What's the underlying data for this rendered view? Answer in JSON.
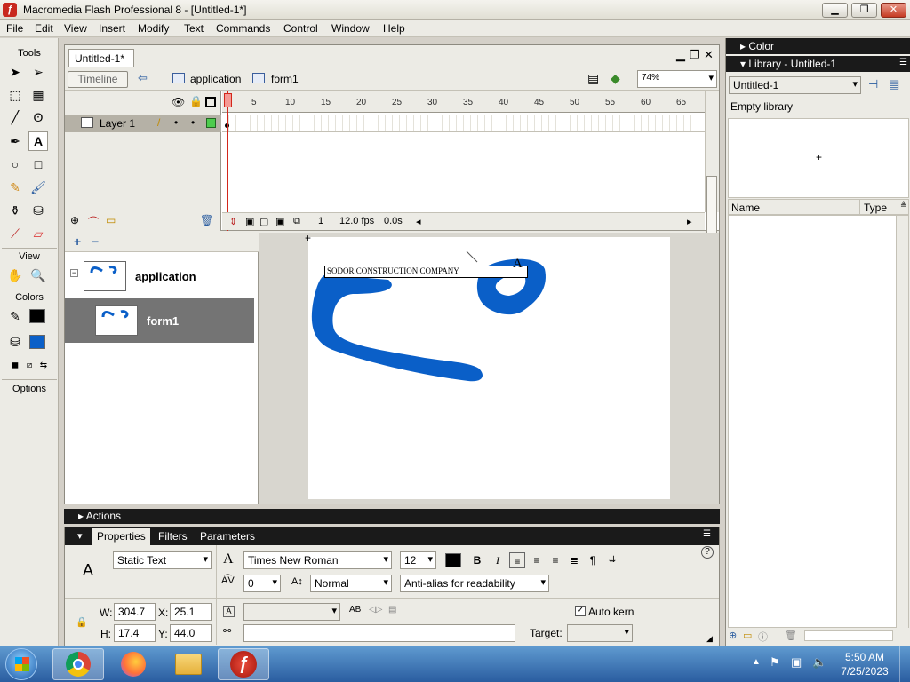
{
  "window": {
    "title": "Macromedia Flash Professional 8 - [Untitled-1*]",
    "minimize": "▁",
    "maximize": "❐",
    "close": "✕"
  },
  "menu": [
    "File",
    "Edit",
    "View",
    "Insert",
    "Modify",
    "Text",
    "Commands",
    "Control",
    "Window",
    "Help"
  ],
  "tools": {
    "header": "Tools",
    "view_header": "View",
    "colors_header": "Colors",
    "options_header": "Options",
    "stroke_color": "#000000",
    "fill_color": "#0a5fc8"
  },
  "document": {
    "tab": "Untitled-1*",
    "timeline_button": "Timeline",
    "breadcrumb": [
      "application",
      "form1"
    ],
    "zoom": "74%"
  },
  "timeline": {
    "layer_name": "Layer 1",
    "frame_ticks": [
      "5",
      "10",
      "15",
      "20",
      "25",
      "30",
      "35",
      "40",
      "45",
      "50",
      "55",
      "60",
      "65"
    ],
    "current_frame": "1",
    "fps": "12.0 fps",
    "time": "0.0s"
  },
  "screens": {
    "items": [
      {
        "name": "application",
        "selected": false
      },
      {
        "name": "form1",
        "selected": true
      }
    ]
  },
  "stage": {
    "text_field": "SODOR CONSTRUCTION COMPANY",
    "shape_color": "#0a5fc8"
  },
  "actions_panel": {
    "label": "Actions"
  },
  "properties": {
    "tabs": [
      "Properties",
      "Filters",
      "Parameters"
    ],
    "text_type": "Static Text",
    "font": "Times New Roman",
    "font_size": "12",
    "letter_spacing": "0",
    "position": "Normal",
    "antialias": "Anti-alias for readability",
    "width_label": "W:",
    "width": "304.7",
    "height_label": "H:",
    "height": "17.4",
    "x_label": "X:",
    "x": "25.1",
    "y_label": "Y:",
    "y": "44.0",
    "auto_kern": "Auto kern",
    "target_label": "Target:"
  },
  "right_panel": {
    "color_header": "Color",
    "library_header": "Library - Untitled-1",
    "library_select": "Untitled-1",
    "empty_library": "Empty library",
    "col_name": "Name",
    "col_type": "Type"
  },
  "taskbar": {
    "time": "5:50 AM",
    "date": "7/25/2023"
  }
}
